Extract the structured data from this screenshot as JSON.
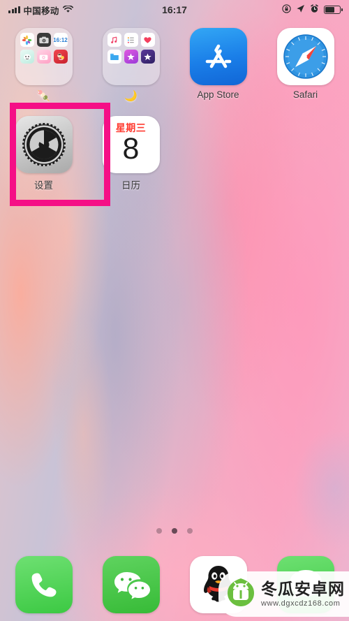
{
  "status_bar": {
    "carrier": "中国移动",
    "time": "16:17",
    "signal_icon": "cellular-signal-icon",
    "wifi_icon": "wifi-icon",
    "rotation_lock_icon": "rotation-lock-icon",
    "location_icon": "location-arrow-icon",
    "alarm_icon": "alarm-clock-icon",
    "battery_icon": "battery-icon",
    "battery_level": 58
  },
  "home_screen": {
    "rows": [
      {
        "apps": [
          {
            "name": "folder-1",
            "label": "🍡",
            "type": "folder",
            "mini_icons": [
              "photos-icon",
              "camera-icon",
              "clock-icon",
              "white-app-icon",
              "pink-camera-icon",
              "red-app-icon"
            ]
          },
          {
            "name": "folder-2",
            "label": "🌙",
            "type": "folder",
            "mini_icons": [
              "music-icon",
              "reminders-icon",
              "health-icon",
              "files-icon",
              "itunes-store-icon",
              "imovie-icon"
            ]
          },
          {
            "name": "app-store",
            "label": "App Store",
            "type": "app",
            "icon": "app-store-icon",
            "color": "#1a7ee8"
          },
          {
            "name": "safari",
            "label": "Safari",
            "type": "app",
            "icon": "safari-compass-icon",
            "color": "#1e88e5"
          }
        ]
      },
      {
        "apps": [
          {
            "name": "settings",
            "label": "设置",
            "type": "app",
            "icon": "settings-gear-icon",
            "color": "#b8b8b8",
            "highlighted": true
          },
          {
            "name": "calendar",
            "label": "日历",
            "type": "app",
            "icon": "calendar-icon",
            "day_of_week": "星期三",
            "day_number": "8",
            "dow_color": "#ff3b30"
          }
        ]
      }
    ]
  },
  "page_indicator": {
    "total": 3,
    "active_index": 1
  },
  "dock": {
    "apps": [
      {
        "name": "phone",
        "icon": "phone-handset-icon",
        "color": "#3cc943"
      },
      {
        "name": "wechat",
        "icon": "wechat-bubbles-icon",
        "color": "#37bb37"
      },
      {
        "name": "qq",
        "icon": "qq-penguin-icon",
        "color": "#ffffff"
      },
      {
        "name": "messages",
        "icon": "messages-bubble-icon",
        "color": "#3cc943"
      }
    ]
  },
  "watermark": {
    "title": "冬瓜安卓网",
    "url": "www.dgxcdz168.com",
    "logo_icon": "android-melon-logo-icon",
    "color": "#6bbf3f"
  },
  "highlight": {
    "color": "#f50f86",
    "target": "settings"
  }
}
